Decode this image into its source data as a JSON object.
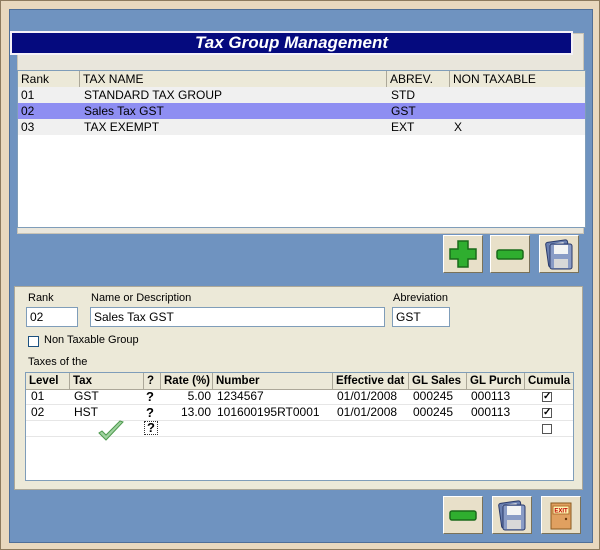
{
  "window": {
    "title": "Tax Group Management"
  },
  "groups_table": {
    "columns": [
      "Rank",
      "TAX NAME",
      "ABREV.",
      "NON TAXABLE"
    ],
    "rows": [
      {
        "rank": "01",
        "name": "STANDARD TAX GROUP",
        "abrev": "STD",
        "non_taxable": ""
      },
      {
        "rank": "02",
        "name": "Sales Tax GST",
        "abrev": "GST",
        "non_taxable": ""
      },
      {
        "rank": "03",
        "name": "TAX EXEMPT",
        "abrev": "EXT",
        "non_taxable": "X"
      }
    ],
    "selected_index": 1
  },
  "toolbar_top": {
    "add_icon": "plus-icon",
    "remove_icon": "minus-icon",
    "save_icon": "floppy-disk-icon"
  },
  "form": {
    "rank_label": "Rank",
    "rank_value": "02",
    "name_label": "Name or Description",
    "name_value": "Sales Tax GST",
    "abrev_label": "Abreviation",
    "abrev_value": "GST",
    "non_taxable_label": "Non Taxable Group",
    "non_taxable_checked": false,
    "taxes_label": "Taxes of the"
  },
  "taxes_table": {
    "columns": [
      "Level",
      "Tax",
      "?",
      "Rate (%)",
      "Number",
      "Effective dat",
      "GL Sales",
      "GL Purch",
      "Cumula"
    ],
    "rows": [
      {
        "level": "01",
        "tax": "GST",
        "q": "?",
        "rate": "5.00",
        "number": "1234567",
        "effective": "01/01/2008",
        "gl_sales": "000245",
        "gl_purch": "000113",
        "cumulative": true
      },
      {
        "level": "02",
        "tax": "HST",
        "q": "?",
        "rate": "13.00",
        "number": "101600195RT0001",
        "effective": "01/01/2008",
        "gl_sales": "000245",
        "gl_purch": "000113",
        "cumulative": true
      },
      {
        "level": "",
        "tax": "",
        "q": "?",
        "rate": "",
        "number": "",
        "effective": "",
        "gl_sales": "",
        "gl_purch": "",
        "cumulative": false
      }
    ]
  },
  "toolbar_bottom": {
    "remove_icon": "minus-icon",
    "save_icon": "floppy-disk-icon",
    "exit_icon": "exit-door-icon",
    "exit_sign": "EXIT"
  },
  "colors": {
    "title_bg": "#050a7e",
    "frame_bg": "#6f93c0",
    "selected_row": "#8e8ef2"
  }
}
